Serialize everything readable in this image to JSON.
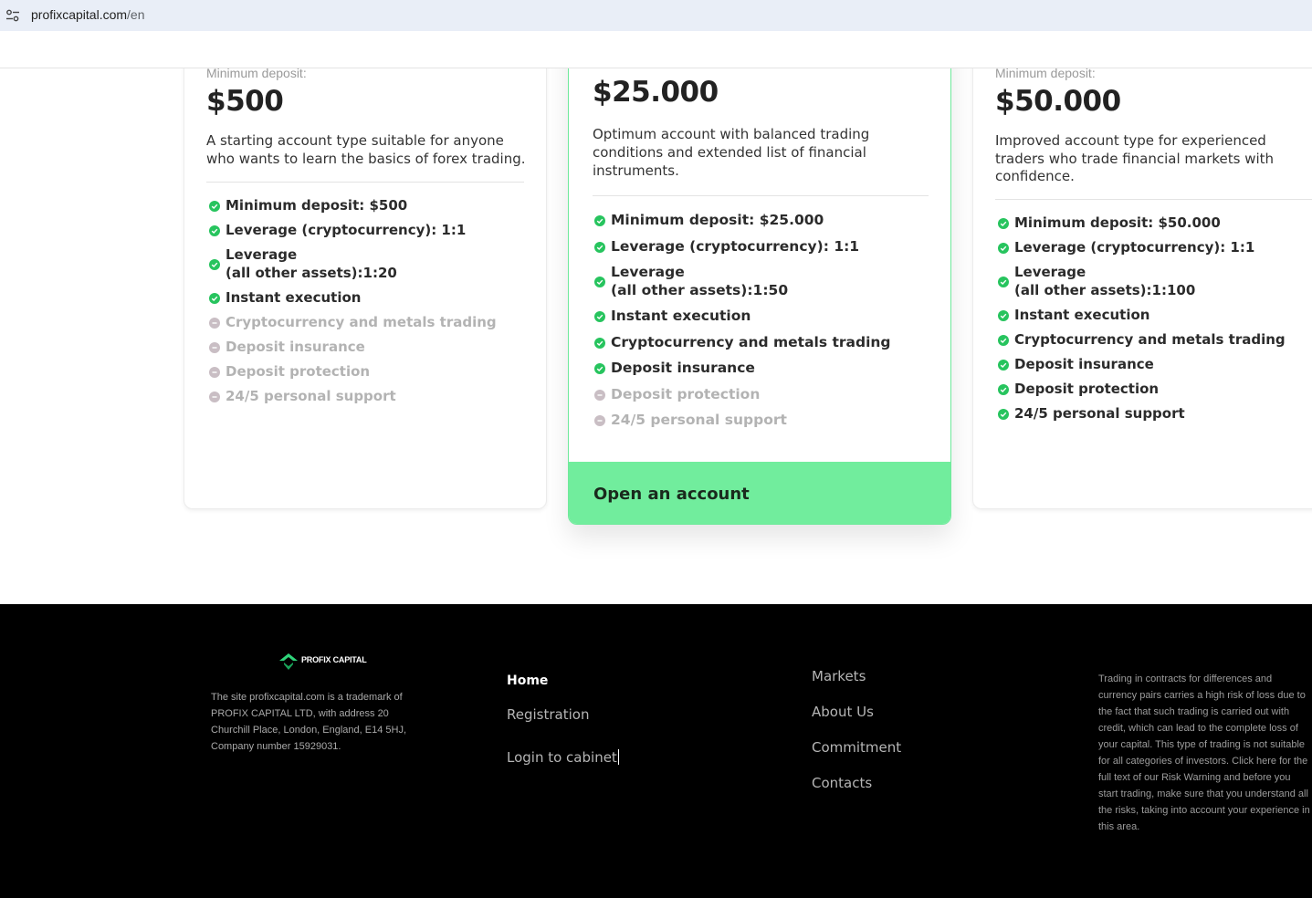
{
  "browser": {
    "url_host": "profixcapital.com",
    "url_path": "/en",
    "site_info_icon": "tune-icon"
  },
  "accounts": [
    {
      "min_deposit_label": "Minimum deposit:",
      "price": "$500",
      "description": "A starting account type suitable for anyone who wants to learn the basics of forex trading.",
      "features": [
        {
          "text": "Minimum deposit: $500",
          "included": true
        },
        {
          "text": "Leverage (cryptocurrency): 1:1",
          "included": true
        },
        {
          "line1": "Leverage",
          "line2": "(all other assets):1:20",
          "included": true
        },
        {
          "text": "Instant execution",
          "included": true
        },
        {
          "text": "Cryptocurrency and metals trading",
          "included": false
        },
        {
          "text": "Deposit insurance",
          "included": false
        },
        {
          "text": "Deposit protection",
          "included": false
        },
        {
          "text": "24/5 personal support",
          "included": false
        }
      ]
    },
    {
      "price": "$25.000",
      "description": "Optimum account with balanced trading conditions and extended list of financial instruments.",
      "features": [
        {
          "text": "Minimum deposit: $25.000",
          "included": true
        },
        {
          "text": "Leverage (cryptocurrency): 1:1",
          "included": true
        },
        {
          "line1": "Leverage",
          "line2": "(all other assets):1:50",
          "included": true
        },
        {
          "text": "Instant execution",
          "included": true
        },
        {
          "text": "Cryptocurrency and metals trading",
          "included": true
        },
        {
          "text": "Deposit insurance",
          "included": true
        },
        {
          "text": "Deposit protection",
          "included": false
        },
        {
          "text": "24/5 personal support",
          "included": false
        }
      ],
      "button": "Open an account"
    },
    {
      "min_deposit_label": "Minimum deposit:",
      "price": "$50.000",
      "description": "Improved account type for experienced traders who trade financial markets with confidence.",
      "features": [
        {
          "text": "Minimum deposit: $50.000",
          "included": true
        },
        {
          "text": "Leverage (cryptocurrency): 1:1",
          "included": true
        },
        {
          "line1": "Leverage",
          "line2": "(all other assets):1:100",
          "included": true
        },
        {
          "text": "Instant execution",
          "included": true
        },
        {
          "text": "Cryptocurrency and metals trading",
          "included": true
        },
        {
          "text": "Deposit insurance",
          "included": true
        },
        {
          "text": "Deposit protection",
          "included": true
        },
        {
          "text": "24/5 personal support",
          "included": true
        }
      ]
    }
  ],
  "footer": {
    "logo_text": "PROFIX CAPITAL",
    "about": "The site profixcapital.com is a trademark of PROFIX CAPITAL LTD, with address 20 Churchill Place, London, England, E14 5HJ, Company number 15929031.",
    "nav_col1": [
      "Home",
      "Registration",
      "Login to cabinet"
    ],
    "nav_col2": [
      "Markets",
      "About Us",
      "Commitment",
      "Contacts"
    ],
    "risk_warning": "Trading in contracts for differences and currency pairs carries a high risk of loss due to the fact that such trading is carried out with credit, which can lead to the complete loss of your capital. This type of trading is not suitable for all categories of investors. Click here for the full text of our Risk Warning and before you start trading, make sure that you understand all the risks, taking into account your experience in this area."
  },
  "colors": {
    "accent_green": "#71ed9d",
    "check_green": "#27c45e",
    "disabled_dot": "#c9bec4",
    "footer_bg": "#000000"
  }
}
